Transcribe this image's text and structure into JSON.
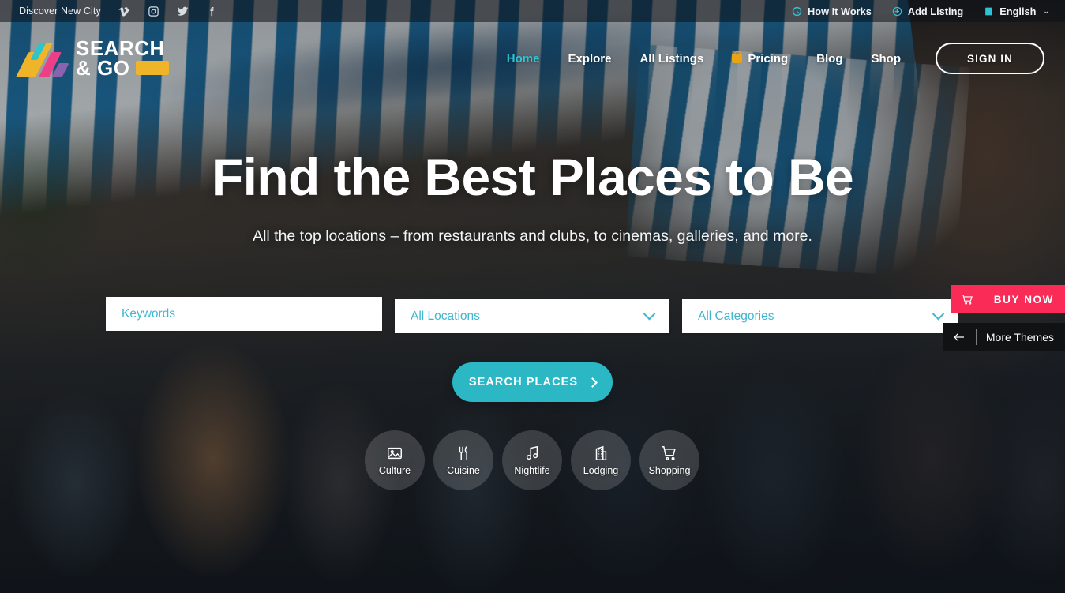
{
  "topbar": {
    "tagline": "Discover New City",
    "socials": [
      {
        "name": "vimeo-icon",
        "label": "Vimeo"
      },
      {
        "name": "instagram-icon",
        "label": "Instagram"
      },
      {
        "name": "twitter-icon",
        "label": "Twitter"
      },
      {
        "name": "facebook-icon",
        "label": "Facebook"
      }
    ],
    "links": [
      {
        "label": "How It Works",
        "icon": "clock-icon"
      },
      {
        "label": "Add Listing",
        "icon": "plus-circle-icon"
      }
    ],
    "language": {
      "label": "English",
      "icon": "flag-icon",
      "chevron": "⌄"
    }
  },
  "header": {
    "logo": {
      "line1": "SEARCH",
      "line2": "& GO"
    },
    "nav": [
      {
        "label": "Home",
        "active": true
      },
      {
        "label": "Explore",
        "active": false
      },
      {
        "label": "All Listings",
        "active": false
      },
      {
        "label": "Pricing",
        "active": false,
        "icon": "tag-icon"
      },
      {
        "label": "Blog",
        "active": false
      },
      {
        "label": "Shop",
        "active": false
      }
    ],
    "signin_label": "SIGN IN"
  },
  "hero": {
    "title": "Find the Best Places to Be",
    "subtitle": "All the top locations – from restaurants and clubs, to cinemas, galleries, and more."
  },
  "search": {
    "keywords": {
      "value": "",
      "placeholder": "Keywords"
    },
    "locations": {
      "selected": "All Locations"
    },
    "categories": {
      "selected": "All Categories"
    },
    "button_label": "SEARCH PLACES"
  },
  "categories": [
    {
      "label": "Culture",
      "icon": "image-icon"
    },
    {
      "label": "Cuisine",
      "icon": "utensils-icon"
    },
    {
      "label": "Nightlife",
      "icon": "music-note-icon"
    },
    {
      "label": "Lodging",
      "icon": "building-icon"
    },
    {
      "label": "Shopping",
      "icon": "shopping-cart-icon"
    }
  ],
  "widgets": {
    "buy_now": {
      "label": "BUY NOW",
      "icon": "cart-icon",
      "color": "#fb2b58"
    },
    "more_themes": {
      "label": "More Themes",
      "icon": "arrow-left-icon",
      "color": "#111214"
    }
  },
  "theme": {
    "accent": "#2bb8c4",
    "accent_text": "#3fb6cf",
    "logo_yellow": "#f0b429",
    "logo_teal": "#2ec4c9",
    "logo_pink": "#ec3f87",
    "logo_purple": "#8a63b0",
    "nav_active": "#2ec4d6"
  }
}
